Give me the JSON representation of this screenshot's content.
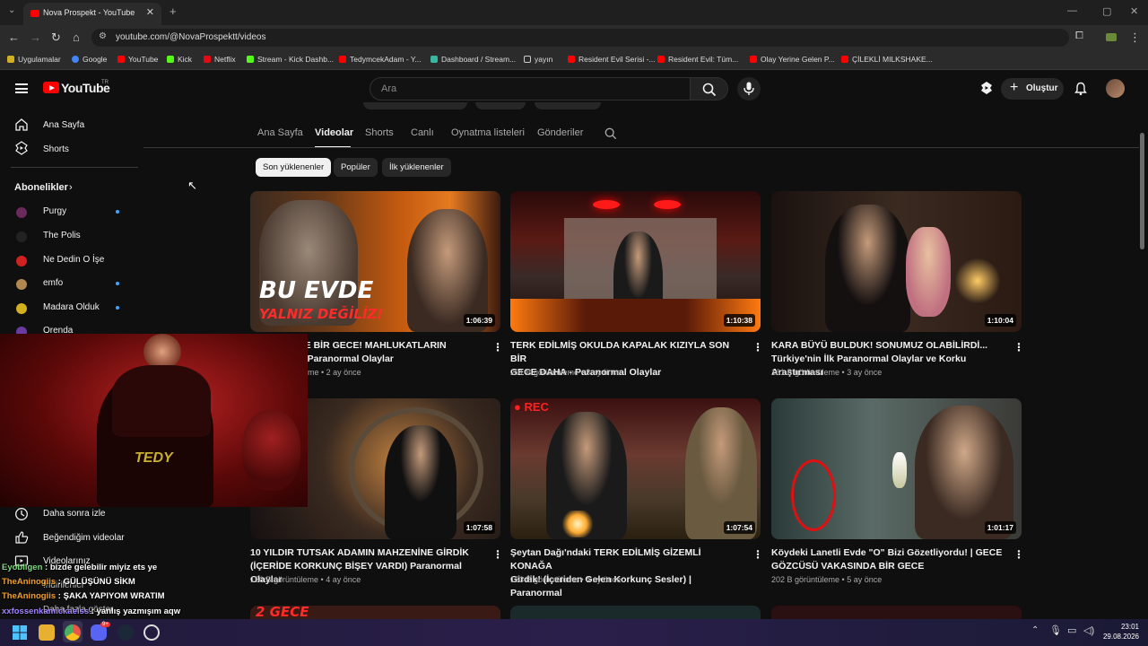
{
  "browser": {
    "tab_title": "Nova Prospekt - YouTube",
    "url": "youtube.com/@NovaProspektt/videos",
    "bookmarks": [
      "Uygulamalar",
      "Google",
      "YouTube",
      "Kick",
      "Netflix",
      "Stream - Kick Dashb...",
      "TedymcekAdam - Y...",
      "Dashboard / Stream...",
      "yayın",
      "Resident Evil Serisi -...",
      "Resident Evil: Tüm...",
      "Olay Yerine Gelen P...",
      "ÇİLEKLİ MILKSHAKE..."
    ]
  },
  "header": {
    "logo_text": "YouTube",
    "logo_sup": "TR",
    "search_placeholder": "Ara",
    "create_label": "Oluştur",
    "icons": [
      "menu-icon",
      "search-icon",
      "mic-icon",
      "shorts-icon",
      "plus-icon",
      "bell-icon"
    ]
  },
  "sidebar": {
    "home": "Ana Sayfa",
    "shorts": "Shorts",
    "subscriptions_title": "Abonelikler",
    "subscriptions": [
      {
        "name": "Purgy",
        "dot": true,
        "color": "#6a2a5a"
      },
      {
        "name": "The Polis",
        "dot": false,
        "color": "#222222"
      },
      {
        "name": "Ne Dedin O İşe",
        "dot": false,
        "color": "#d02020"
      },
      {
        "name": "emfo",
        "dot": true,
        "color": "#b08850"
      },
      {
        "name": "Madara Olduk",
        "dot": true,
        "color": "#d4b020"
      },
      {
        "name": "Orenda",
        "dot": false,
        "color": "#6a3aa0"
      }
    ],
    "watch_later": "Daha sonra izle",
    "liked": "Beğendiğim videolar",
    "your_videos": "Videolarınız",
    "downloads": "İndirilenler",
    "show_more": "Daha fazla göster"
  },
  "channel_tabs": [
    "Ana Sayfa",
    "Videolar",
    "Shorts",
    "Canlı",
    "Oynatma listeleri",
    "Gönderiler"
  ],
  "active_tab": "Videolar",
  "chips": [
    "Son yüklenenler",
    "Popüler",
    "İlk yüklenenler"
  ],
  "videos": [
    {
      "title": "...CİNLİ KÖYDE BİR GECE! MAHLUKATLARIN ...LDUĞU EV - Paranormal Olaylar",
      "line1": "CİNLİ KÖYDE BİR GECE! MAHLUKATLARIN",
      "line2": "LDUĞU EV - Paranormal Olaylar",
      "meta": "me • 2 ay önce",
      "duration": "1:06:39",
      "overlay1": "BU EVDE",
      "overlay2": "YALNIZ DEĞİLİZ!"
    },
    {
      "title": "TERK EDİLMİŞ OKULDA KAPALAK KIZIYLA SON BİR GECE DAHA - Paranormal Olaylar",
      "line1": "TERK EDİLMİŞ OKULDA KAPALAK KIZIYLA SON BİR",
      "line2": "GECE DAHA - Paranormal Olaylar",
      "meta": "201 B görüntüleme • 3 ay önce",
      "duration": "1:10:38"
    },
    {
      "title": "KARA BÜYÜ BULDUK! SONUMUZ OLABİLİRDİ... Türkiye'nin İlk Paranormal Olaylar ve Korku Araştırması",
      "line1": "KARA BÜYÜ BULDUK! SONUMUZ OLABİLİRDİ...",
      "line2": "Türkiye'nin İlk Paranormal Olaylar ve Korku Araştırması",
      "meta": "161 B görüntüleme • 3 ay önce",
      "duration": "1:10:04"
    },
    {
      "title": "10 YILDIR TUTSAK ADAMIN MAHZENİNE GİRDİK (İÇERİDE KORKUNÇ BİŞEY VARDI) Paranormal Olaylar",
      "line1": "10 YILDIR TUTSAK ADAMIN MAHZENİNE GİRDİK",
      "line2": "(İÇERİDE KORKUNÇ BİŞEY VARDI) Paranormal Olaylar",
      "meta": "150 B görüntüleme • 4 ay önce",
      "duration": "1:07:58"
    },
    {
      "title": "Şeytan Dağı'ndaki TERK EDİLMİŞ GİZEMLİ KONAĞA Girdik! (İçeriden Gelen Korkunç Sesler) | Paranormal",
      "line1": "Şeytan Dağı'ndaki TERK EDİLMİŞ GİZEMLİ KONAĞA",
      "line2": "Girdik! (İçeriden Gelen Korkunç Sesler) | Paranormal",
      "meta": "183 B görüntüleme • 4 ay önce",
      "duration": "1:07:54",
      "badge": "REC"
    },
    {
      "title": "Köydeki Lanetli Evde \"O\" Bizi Gözetliyordu! | GECE GÖZCÜSÜ VAKASINDA BİR GECE",
      "line1": "Köydeki Lanetli Evde \"O\" Bizi Gözetliyordu! | GECE",
      "line2": "GÖZCÜSÜ VAKASINDA BİR GECE",
      "meta": "202 B görüntüleme • 5 ay önce",
      "duration": "1:01:17"
    }
  ],
  "partial_row": {
    "text1": "2 GECE"
  },
  "chat": [
    {
      "user": "Eyobilgen",
      "msg": "bizde gelebilir miyiz ets ye",
      "color": "#7fd67f"
    },
    {
      "user": "TheAninogiis",
      "msg": "GÜLÜŞÜNÜ SİKM",
      "color": "#f0a030"
    },
    {
      "user": "TheAninogiis",
      "msg": "ŞAKA YAPIYOM WRATIM",
      "color": "#f0a030"
    },
    {
      "user": "xxfossenkamickaelss",
      "msg": "yanlış yazmışım aqw",
      "color": "#a080ff"
    }
  ],
  "webcam_chair_text": "TEDY",
  "taskbar": {
    "time": "23:01",
    "date": "29.08.2026",
    "discord_badge": "9+"
  }
}
